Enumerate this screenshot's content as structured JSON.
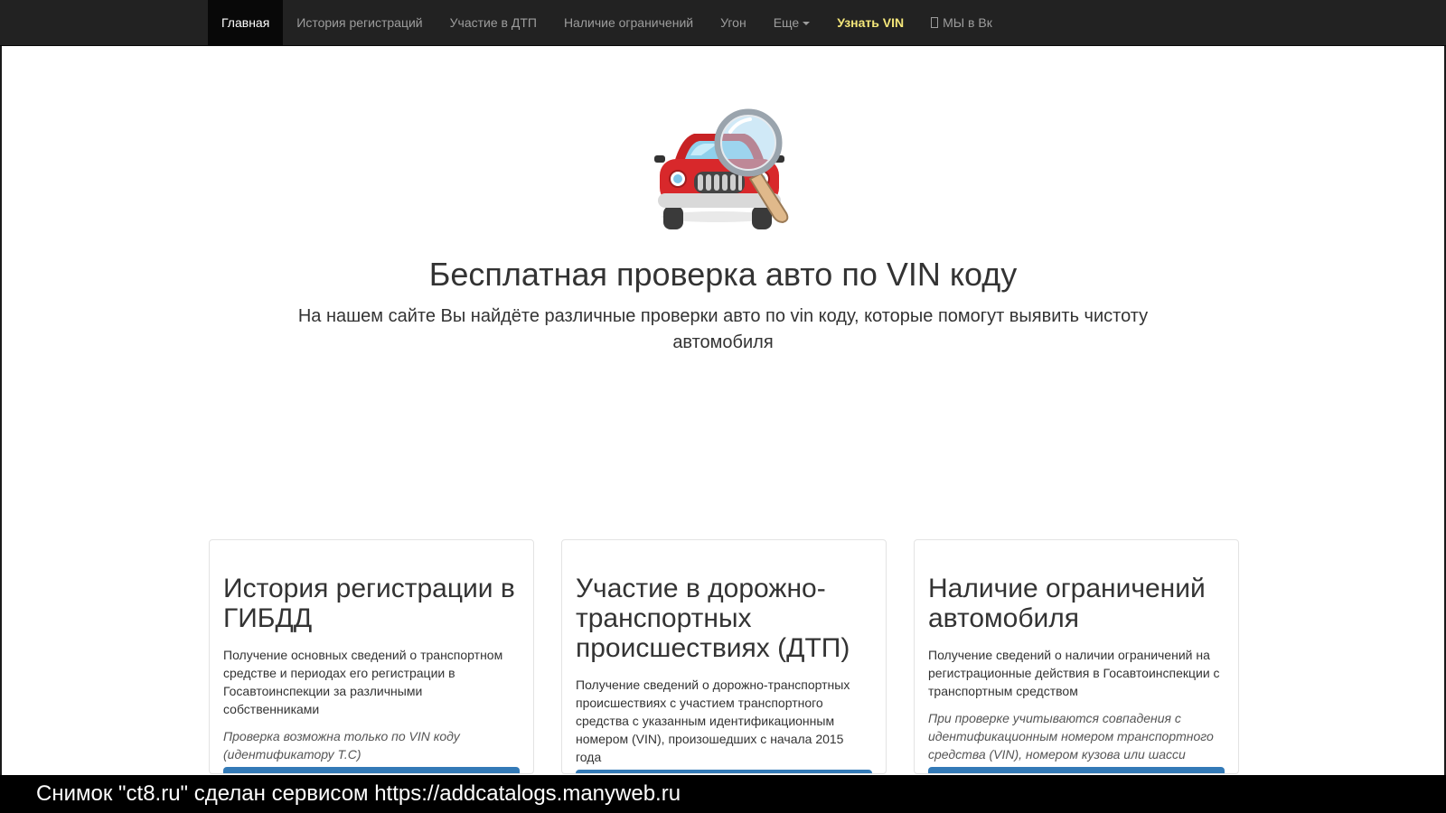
{
  "nav": {
    "items": [
      {
        "label": "Главная",
        "state": "active"
      },
      {
        "label": "История регистраций"
      },
      {
        "label": "Участие в ДТП"
      },
      {
        "label": "Наличие ограничений"
      },
      {
        "label": "Угон"
      },
      {
        "label": "Еще"
      },
      {
        "label": "Узнать VIN",
        "state": "highlight"
      },
      {
        "label": "МЫ в Вк",
        "icon": "vk-icon"
      }
    ]
  },
  "hero": {
    "image": "car-magnifier-icon",
    "title": "Бесплатная проверка авто по VIN коду",
    "subtitle": "На нашем сайте Вы найдёте различные проверки авто по vin коду, которые помогут выявить чистоту автомобиля"
  },
  "cards": [
    {
      "title": "История регистрации в ГИБДД",
      "text": "Получение основных сведений о транспортном средстве и периодах его регистрации в Госавтоинспекции за различными собственниками",
      "note": "Проверка возможна только по VIN коду (идентификатору Т.С)"
    },
    {
      "title": "Участие в дорожно-транспортных происшествиях (ДТП)",
      "text": "Получение сведений о дорожно-транспортных происшествиях с участием транспортного средства с указанным идентификационным номером (VIN), произошедших с начала 2015 года",
      "note": ""
    },
    {
      "title": "Наличие ограничений автомобиля",
      "text": "Получение сведений о наличии ограничений на регистрационные действия в Госавтоинспекции с транспортным средством",
      "note": "При проверке учитываются совпадения с идентификационным номером транспортного средства (VIN), номером кузова или шасси"
    }
  ],
  "footer": {
    "text": "Снимок \"ct8.ru\" сделан сервисом https://addcatalogs.manyweb.ru"
  },
  "colors": {
    "navbar": "#222222",
    "nav_active": "#080808",
    "nav_highlight": "#f5e77a",
    "button": "#337ab7",
    "car": "#d8282b"
  }
}
